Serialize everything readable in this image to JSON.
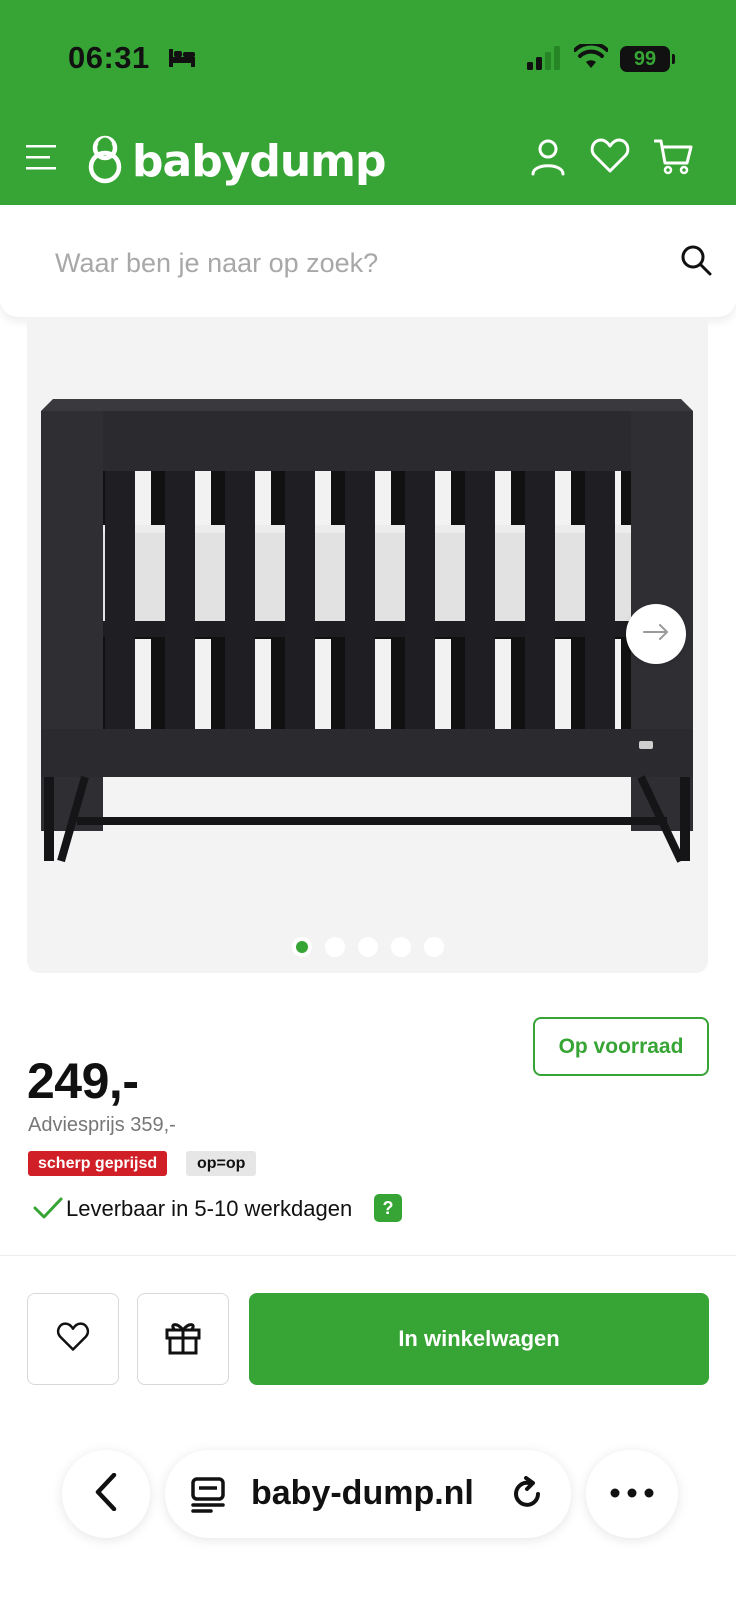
{
  "status_bar": {
    "time": "06:31",
    "battery": "99",
    "icons": [
      "bed-icon",
      "signal-icon",
      "wifi-icon",
      "battery-icon"
    ]
  },
  "header": {
    "brand": "babydump",
    "brand_color": "#37a535",
    "icons": [
      "menu-icon",
      "account-icon",
      "heart-icon",
      "cart-icon"
    ]
  },
  "search": {
    "placeholder": "Waar ben je naar op zoek?"
  },
  "gallery": {
    "image": "crib",
    "slide_count": 5,
    "active_slide": 1
  },
  "product": {
    "stock_label": "Op voorraad",
    "price": "249,-",
    "list_price": "Adviesprijs 359,-",
    "badge_sharp": "scherp geprijsd",
    "badge_stock": "op=op",
    "delivery": "Leverbaar in 5-10 werkdagen",
    "help": "?"
  },
  "actions": {
    "cart_label": "In winkelwagen"
  },
  "browser": {
    "url": "baby-dump.nl"
  }
}
